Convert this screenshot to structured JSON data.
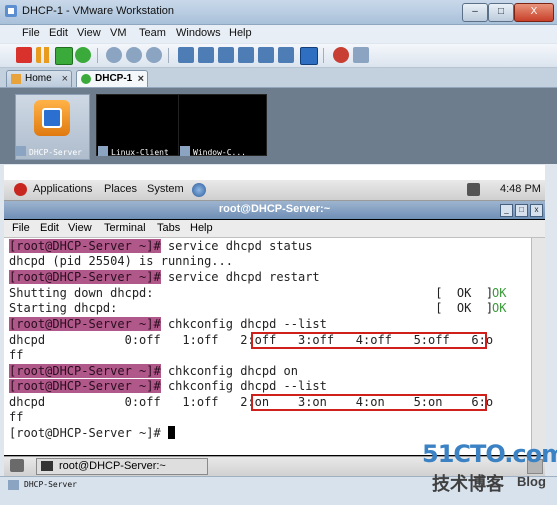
{
  "window": {
    "title": "DHCP-1 - VMware Workstation",
    "min_label": "–",
    "max_label": "□",
    "close_label": "X"
  },
  "menubar": [
    "File",
    "Edit",
    "View",
    "VM",
    "Team",
    "Windows",
    "Help"
  ],
  "tabs": [
    {
      "label": "Home",
      "close": "×"
    },
    {
      "label": "DHCP-1",
      "close": "×"
    }
  ],
  "thumbnails": [
    "DHCP-Server",
    "Linux-Client",
    "Window-C..."
  ],
  "gnome_panel": {
    "applications": "Applications",
    "places": "Places",
    "system": "System",
    "clock": "4:48 PM"
  },
  "terminal": {
    "title": "root@DHCP-Server:~",
    "menu": [
      "File",
      "Edit",
      "View",
      "Terminal",
      "Tabs",
      "Help"
    ],
    "lines": [
      {
        "prompt": "[root@DHCP-Server ~]#",
        "text": " service dhcpd status"
      },
      {
        "prompt": "",
        "text": "dhcpd (pid 25504) is running..."
      },
      {
        "prompt": "[root@DHCP-Server ~]#",
        "text": " service dhcpd restart"
      },
      {
        "prompt": "",
        "text": "Shutting down dhcpd:                                       [  OK  ]"
      },
      {
        "prompt": "",
        "text": "Starting dhcpd:                                            [  OK  ]"
      },
      {
        "prompt": "[root@DHCP-Server ~]#",
        "text": " chkconfig dhcpd --list"
      },
      {
        "prompt": "",
        "text": "dhcpd           0:off   1:off   2:off   3:off   4:off   5:off   6:o"
      },
      {
        "prompt": "",
        "text": "ff"
      },
      {
        "prompt": "[root@DHCP-Server ~]#",
        "text": " chkconfig dhcpd on"
      },
      {
        "prompt": "[root@DHCP-Server ~]#",
        "text": " chkconfig dhcpd --list"
      },
      {
        "prompt": "",
        "text": "dhcpd           0:off   1:off   2:on    3:on    4:on    5:on    6:o"
      },
      {
        "prompt": "",
        "text": "ff"
      },
      {
        "prompt": "",
        "text": "[root@DHCP-Server ~]# "
      }
    ],
    "ok_label": "OK"
  },
  "taskbar": {
    "item": "root@DHCP-Server:~"
  },
  "vm_status": {
    "label": "DHCP-Server"
  },
  "watermark": {
    "main": "51CTO.com",
    "sub": "技术博客",
    "blog": "Blog"
  },
  "colors": {
    "prompt_bg": "#b0588a",
    "highlight_box": "#d0201c",
    "ok": "#3b9a3b"
  }
}
